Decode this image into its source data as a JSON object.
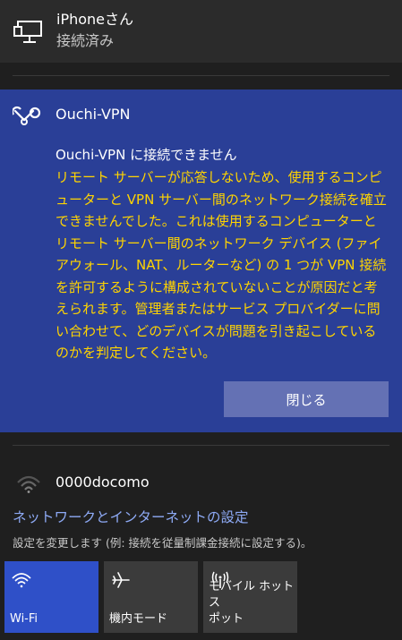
{
  "connected_network": {
    "name": "iPhoneさん",
    "status": "接続済み",
    "icon": "ethernet-monitor-icon"
  },
  "vpn": {
    "name": "Ouchi-VPN",
    "icon": "vpn-link-icon",
    "error_title": "Ouchi-VPN に接続できません",
    "error_message": "リモート サーバーが応答しないため、使用するコンピューターと VPN サーバー間のネットワーク接続を確立できませんでした。これは使用するコンピューターとリモート サーバー間のネットワーク デバイス (ファイアウォール、NAT、ルーターなど) の 1 つが VPN 接続を許可するように構成されていないことが原因だと考えられます。管理者またはサービス プロバイダーに問い合わせて、どのデバイスが問題を引き起こしているのかを判定してください。",
    "close_label": "閉じる"
  },
  "wifi_network": {
    "name": "0000docomo",
    "icon": "wifi-signal-weak-icon"
  },
  "settings": {
    "link_label": "ネットワークとインターネットの設定",
    "description": "設定を変更します (例: 接続を従量制課金接続に設定する)。"
  },
  "quick_actions": [
    {
      "label": "Wi-Fi",
      "icon": "wifi-icon",
      "active": true
    },
    {
      "label": "機内モード",
      "icon": "airplane-icon",
      "active": false
    },
    {
      "label": "モバイル ホットス\nポット",
      "icon": "hotspot-icon",
      "active": false
    }
  ],
  "colors": {
    "panel_bg": "#1f1f1f",
    "vpn_card_bg": "#2a3f97",
    "error_text": "#ffd400",
    "link": "#8eaaf5",
    "active_tile": "#2f50c8",
    "tile": "#3b3b3b"
  }
}
